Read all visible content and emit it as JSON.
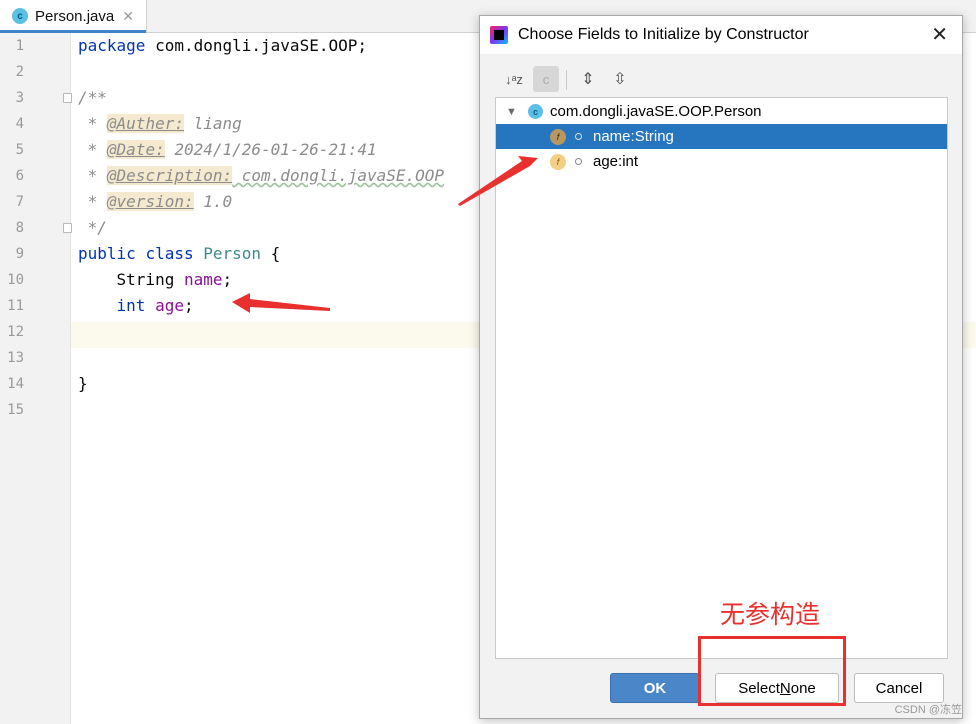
{
  "editor": {
    "tab": {
      "icon_letter": "c",
      "title": "Person.java",
      "close_glyph": "✕"
    },
    "line_numbers": [
      "1",
      "2",
      "3",
      "4",
      "5",
      "6",
      "7",
      "8",
      "9",
      "10",
      "11",
      "12",
      "13",
      "14",
      "15"
    ],
    "lines": {
      "l1": {
        "keyword": "package",
        "rest": " com.dongli.javaSE.OOP;"
      },
      "l3": "/**",
      "l4": {
        "prefix": " * ",
        "tag": "@Auther:",
        "value": " liang"
      },
      "l5": {
        "prefix": " * ",
        "tag": "@Date:",
        "value": " 2024/1/26-01-26-21:41"
      },
      "l6": {
        "prefix": " * ",
        "tag": "@Description:",
        "value": " com.dongli.javaSE.OOP"
      },
      "l7": {
        "prefix": " * ",
        "tag": "@version:",
        "value": " 1.0"
      },
      "l8": " */",
      "l9": {
        "kw1": "public",
        "kw2": "class",
        "name": "Person",
        "brace": " {"
      },
      "l10": {
        "type": "String",
        "field": "name",
        "semi": ";"
      },
      "l11": {
        "type": "int",
        "field": "age",
        "semi": ";"
      },
      "l14": "}"
    }
  },
  "dialog": {
    "title": "Choose Fields to Initialize by Constructor",
    "close_glyph": "✕",
    "toolbar": {
      "sort_icon_text": "↓ᵃz",
      "class_toggle_text": "c",
      "expand_icon_text": "⇕",
      "collapse_icon_text": "⇳"
    },
    "tree": {
      "root": {
        "chevron": "▼",
        "icon_letter": "c",
        "label": "com.dongli.javaSE.OOP.Person"
      },
      "fields": [
        {
          "icon_letter": "f",
          "label": "name:String"
        },
        {
          "icon_letter": "f",
          "label": "age:int"
        }
      ]
    },
    "buttons": {
      "ok": "OK",
      "select_none": {
        "prefix": "Select ",
        "mnemonic": "N",
        "suffix": "one"
      },
      "cancel": "Cancel"
    }
  },
  "annotation": {
    "text": "无参构造",
    "color": "#e8312f"
  },
  "watermark": "CSDN @冻笠"
}
